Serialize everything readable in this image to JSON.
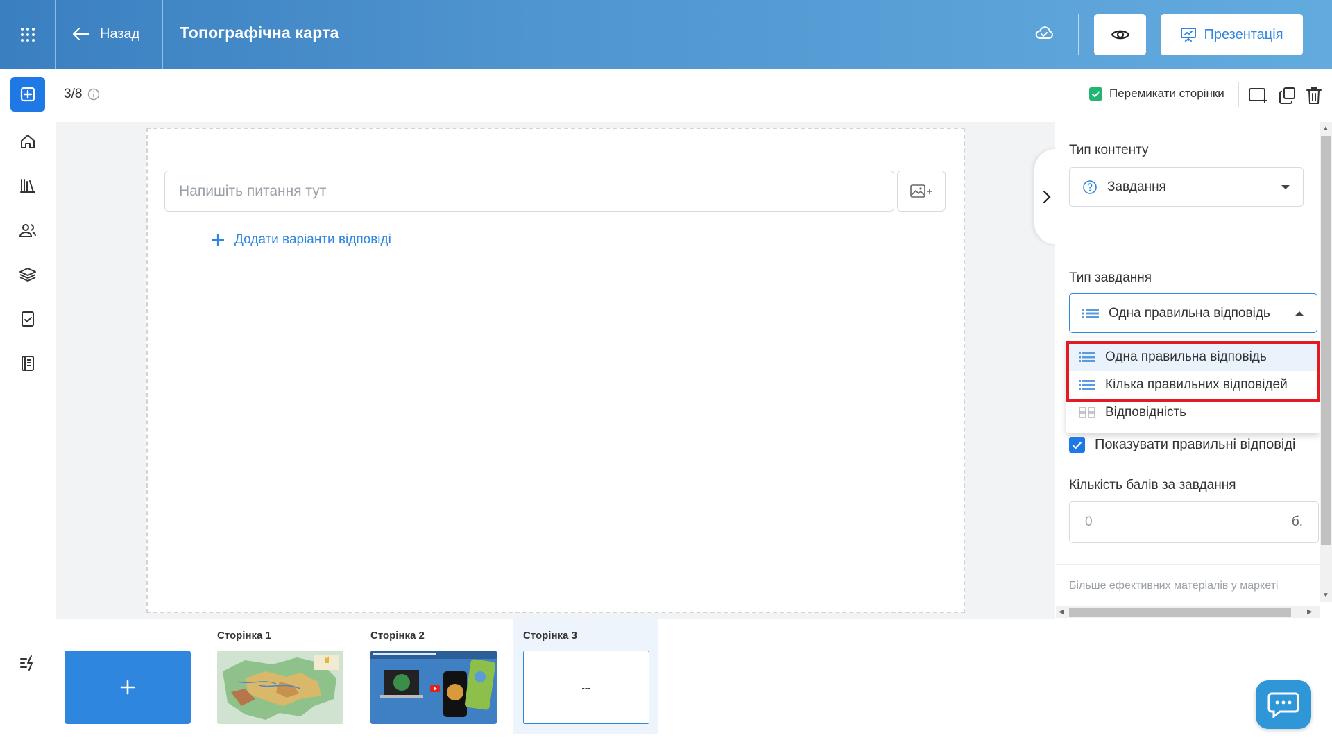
{
  "topbar": {
    "back_label": "Назад",
    "title": "Топографічна карта",
    "present_label": "Презентація"
  },
  "sidebar": {
    "items": [
      "add-icon",
      "home-icon",
      "library-icon",
      "users-icon",
      "courses-icon",
      "assignment-icon",
      "journal-icon",
      "activity-icon"
    ]
  },
  "header": {
    "page_counter": "3/8",
    "switch_pages_label": "Перемикати сторінки",
    "switch_pages_checked": true
  },
  "slide": {
    "question_placeholder": "Напишіть питання тут",
    "add_answers_label": "Додати варіанти відповіді"
  },
  "panel": {
    "content_type_label": "Тип контенту",
    "content_type_value": "Завдання",
    "task_type_label": "Тип завдання",
    "task_type_value": "Одна правильна відповідь",
    "task_type_options": [
      {
        "label": "Одна правильна відповідь",
        "selected": true
      },
      {
        "label": "Кілька правильних відповідей",
        "selected": false
      },
      {
        "label": "Відповідність",
        "selected": false
      }
    ],
    "show_answers_label": "Показувати правильні відповіді",
    "show_answers_checked": true,
    "points_label": "Кількість балів за завдання",
    "points_placeholder": "0",
    "points_unit": "б.",
    "market_link": "Більше ефективних матеріалів у маркеті"
  },
  "pages": {
    "add_label": "+",
    "items": [
      {
        "label": "Сторінка 1"
      },
      {
        "label": "Сторінка 2"
      },
      {
        "label": "Сторінка 3",
        "thumb_text": "---",
        "active": true
      }
    ]
  },
  "colors": {
    "accent": "#2e86de",
    "primary_button": "#1e78e6",
    "highlight_border": "#e31a23",
    "check_green": "#22b573"
  }
}
